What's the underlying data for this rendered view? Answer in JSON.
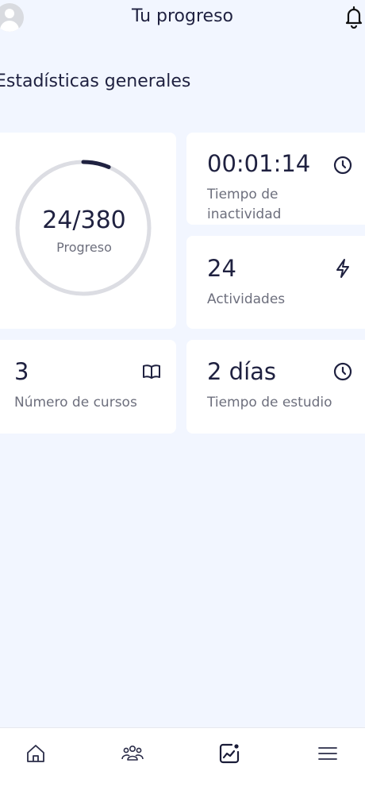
{
  "header": {
    "title": "Tu progreso",
    "avatar_icon": "user-avatar-icon",
    "notification_icon": "bell-icon"
  },
  "section": {
    "title": "Estadísticas generales"
  },
  "progress_card": {
    "value": "24/380",
    "label": "Progreso",
    "completed": 24,
    "total": 380
  },
  "stats": {
    "inactive_time": {
      "value": "00:01:14",
      "label": "Tiempo de inactividad",
      "icon": "clock-icon"
    },
    "activities": {
      "value": "24",
      "label": "Actividades",
      "icon": "lightning-icon"
    },
    "courses": {
      "value": "3",
      "label": "Número de cursos",
      "icon": "book-icon"
    },
    "study_time": {
      "value": "2 días",
      "label": "Tiempo de estudio",
      "icon": "clock-icon"
    }
  },
  "bottom_nav": {
    "items": [
      {
        "icon": "home-icon"
      },
      {
        "icon": "community-icon"
      },
      {
        "icon": "progress-chart-icon",
        "active": true
      },
      {
        "icon": "menu-icon"
      }
    ]
  },
  "colors": {
    "background": "#f2f6ff",
    "card": "#ffffff",
    "text": "#1f2140",
    "muted": "#6d6f7d",
    "ring_track": "#dcdde3",
    "ring_fill": "#1f2140"
  }
}
